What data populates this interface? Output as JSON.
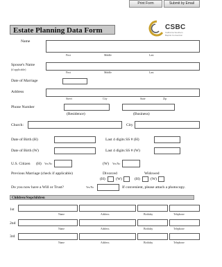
{
  "toolbar": {
    "print_label": "Print Form",
    "submit_label": "Submit by Email"
  },
  "logo": {
    "text": "CSBC",
    "sub1": "California Southern",
    "sub2": "Baptist Convention"
  },
  "form": {
    "title": "Estate Planning Data Form",
    "name_label": "Name",
    "first": "First",
    "middle": "Middle",
    "last": "Last",
    "spouse_label": "Spouse's Name",
    "if_applicable": "(if applicable)",
    "dom_label": "Date of Marriage",
    "address_label": "Address",
    "street": "Street",
    "city_cap": "City",
    "state": "State",
    "zip": "Zip",
    "phone_label": "Phone Number",
    "residence": "(Residence)",
    "business": "(Business)",
    "church_label": "Church:",
    "city_label": "City",
    "dob_h": "Date of Birth (H)",
    "dob_w": "Date of Birth (W)",
    "ssn_h": "Last 4 digits SS # (H)",
    "ssn_w": "Last 4 digits SS # (W)",
    "citizen": "U.S. Citizen",
    "h": "(H)",
    "w": "(W)",
    "yesno": "Yes/No",
    "prev_marriage": "Previous Marriage (check if applicable)",
    "divorced": "Divorced",
    "widowed": "Widowed",
    "h_short": "(H)",
    "w_short": "(W)",
    "will_q": "Do you now have a Will or Trust?",
    "convenient": "If convenient, please attach a photocopy.",
    "children_header": "Children/Stepchildren",
    "row1": "1st",
    "row2": "2nd",
    "row3": "3rd",
    "col_name": "Name",
    "col_address": "Address",
    "col_birthday": "Birthday",
    "col_telephone": "Telephone"
  }
}
